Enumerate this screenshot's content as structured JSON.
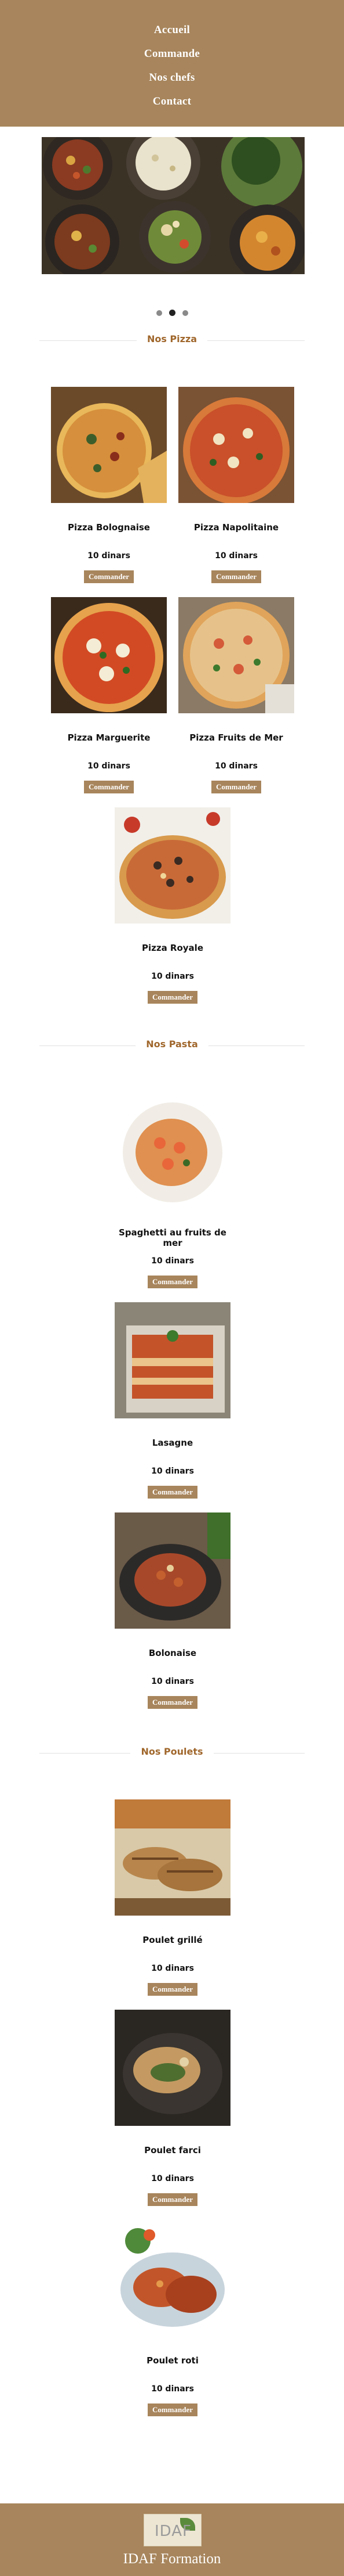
{
  "nav": {
    "items": [
      "Accueil",
      "Commande",
      "Nos chefs",
      "Contact"
    ]
  },
  "hero": {
    "image": "food-platter-photo",
    "slides": 3,
    "active_slide": 2
  },
  "sections": {
    "pizza": "Nos Pizza",
    "pasta": "Nos Pasta",
    "poulets": "Nos Poulets"
  },
  "products": [
    {
      "name": "Pizza Bolognaise",
      "price": "10 dinars",
      "button": "Commander"
    },
    {
      "name": "Pizza Napolitaine",
      "price": "10 dinars",
      "button": "Commander"
    },
    {
      "name": "Pizza Marguerite",
      "price": "10 dinars",
      "button": "Commander"
    },
    {
      "name": "Pizza Fruits de Mer",
      "price": "10 dinars",
      "button": "Commander"
    },
    {
      "name": "Pizza Royale",
      "price": "10 dinars",
      "button": "Commander"
    },
    {
      "name": "Spaghetti au fruits de mer",
      "price": "10 dinars",
      "button": "Commander"
    },
    {
      "name": "Lasagne",
      "price": "10 dinars",
      "button": "Commander"
    },
    {
      "name": "Bolonaise",
      "price": "10 dinars",
      "button": "Commander"
    },
    {
      "name": "Poulet grillé",
      "price": "10 dinars",
      "button": "Commander"
    },
    {
      "name": "Poulet farci",
      "price": "10 dinars",
      "button": "Commander"
    },
    {
      "name": "Poulet roti",
      "price": "10 dinars",
      "button": "Commander"
    }
  ],
  "footer": {
    "logo_text": "IDAF",
    "brand": "IDAF Formation"
  },
  "colors": {
    "brand": "#a8855c",
    "section_title": "#a0672c"
  }
}
